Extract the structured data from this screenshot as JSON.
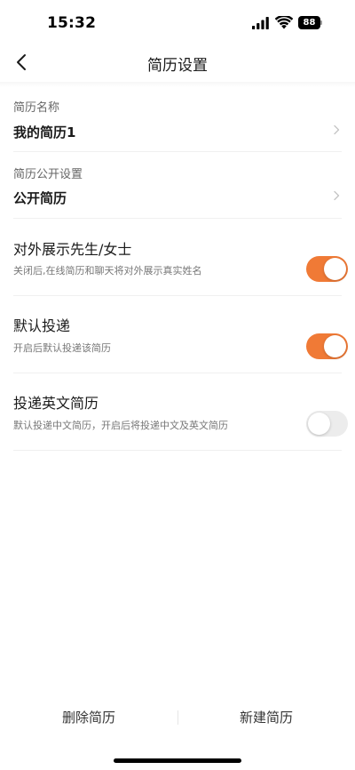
{
  "status_bar": {
    "time": "15:32",
    "battery": "88",
    "icons": [
      "signal-icon",
      "wifi-icon",
      "battery-icon"
    ]
  },
  "nav": {
    "back_icon": "chevron-left-icon",
    "title": "简历设置"
  },
  "resume_name": {
    "caption": "简历名称",
    "value": "我的简历1"
  },
  "resume_visibility": {
    "caption": "简历公开设置",
    "value": "公开简历"
  },
  "toggles": [
    {
      "title": "对外展示先生/女士",
      "description": "关闭后,在线简历和聊天将对外展示真实姓名",
      "on": true
    },
    {
      "title": "默认投递",
      "description": "开启后默认投递该简历",
      "on": true
    },
    {
      "title": "投递英文简历",
      "description": "默认投递中文简历，开启后将投递中文及英文简历",
      "on": false
    }
  ],
  "bottom": {
    "delete_label": "删除简历",
    "create_label": "新建简历"
  },
  "colors": {
    "accent": "#f07a36",
    "toggle_off": "#ececec"
  }
}
